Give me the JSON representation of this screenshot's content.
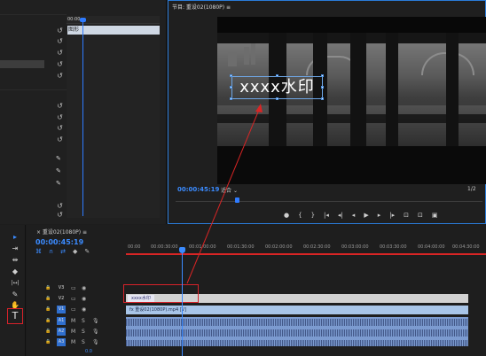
{
  "program_monitor": {
    "title": "节目: 重设02(1080P) ≡",
    "timecode": "00:00:45:19",
    "fit": "适合",
    "resolution": "1/2",
    "watermark_text": "xxxx水印",
    "controls": [
      "●",
      "{",
      "}",
      "|◂",
      "◂|",
      "◂",
      "▶",
      "▸",
      "|▸",
      "⊡",
      "⊡",
      "▣"
    ]
  },
  "effect_controls": {
    "clip_label": "图形",
    "timecode": "00:00"
  },
  "tools": {
    "items": [
      "▸",
      "⇥",
      "⇹",
      "◆",
      "|↔|",
      "✎",
      "✋",
      "T"
    ]
  },
  "timeline": {
    "title": "× 重设02(1080P) ≡",
    "timecode": "00:00:45:19",
    "ruler_labels": [
      "00:00",
      "00:00:30:00",
      "00:01:00:00",
      "00:01:30:00",
      "00:02:00:00",
      "00:02:30:00",
      "00:03:00:00",
      "00:03:30:00",
      "00:04:00:00",
      "00:04:30:00"
    ],
    "tracks": [
      {
        "name": "V3",
        "type": "video"
      },
      {
        "name": "V2",
        "type": "video"
      },
      {
        "name": "V1",
        "type": "video"
      },
      {
        "name": "A1",
        "type": "audio"
      },
      {
        "name": "A2",
        "type": "audio"
      },
      {
        "name": "A3",
        "type": "audio"
      }
    ],
    "master": "0.0",
    "title_clip_label": "xxxx水印",
    "v1_clip_label": "fx 重设02(1080P).mp4 [V]"
  },
  "accent_colors": {
    "blue": "#3b8bff",
    "red": "#d92525"
  }
}
